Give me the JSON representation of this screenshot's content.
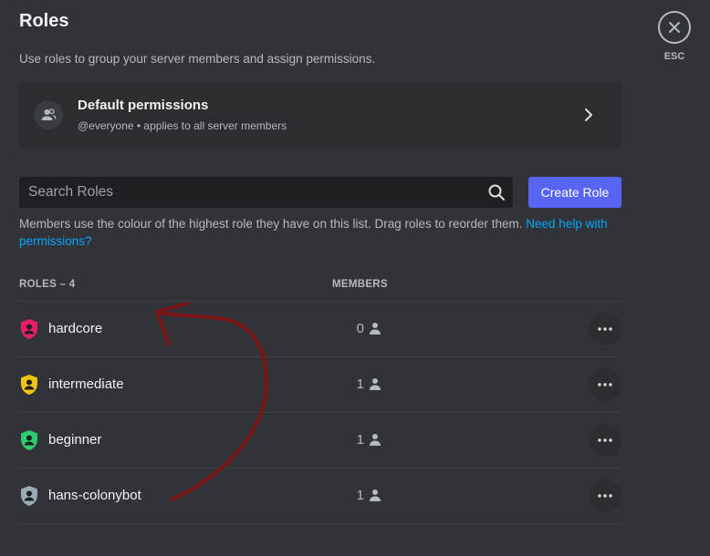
{
  "page": {
    "title": "Roles",
    "subtitle": "Use roles to group your server members and assign permissions."
  },
  "default_permissions": {
    "title": "Default permissions",
    "description": "@everyone • applies to all server members",
    "icon": "members-icon"
  },
  "search": {
    "placeholder": "Search Roles",
    "value": ""
  },
  "create_role_label": "Create Role",
  "help": {
    "text": "Members use the colour of the highest role they have on this list. Drag roles to reorder them. ",
    "link": "Need help with permissions?"
  },
  "table": {
    "roles_header": "ROLES – 4",
    "members_header": "MEMBERS"
  },
  "roles": [
    {
      "name": "hardcore",
      "members": "0",
      "color": "#e91e63"
    },
    {
      "name": "intermediate",
      "members": "1",
      "color": "#f1c40f"
    },
    {
      "name": "beginner",
      "members": "1",
      "color": "#2ecc71"
    },
    {
      "name": "hans-colonybot",
      "members": "1",
      "color": "#99aab5"
    }
  ],
  "close": {
    "label": "ESC"
  },
  "annotation_color": "#7a1414"
}
